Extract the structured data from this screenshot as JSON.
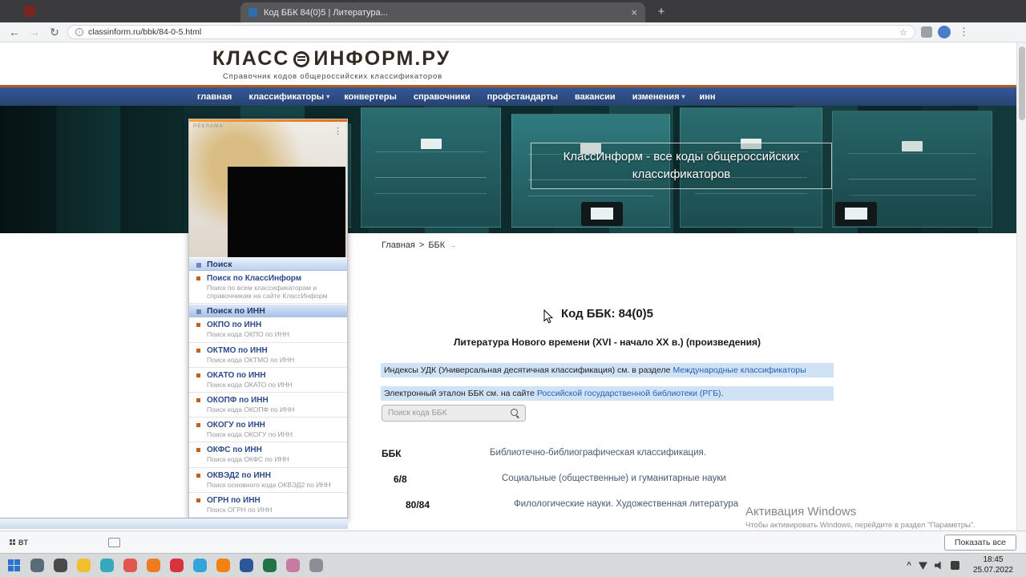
{
  "colors": {
    "accent_orange": "#d96f1e",
    "nav_blue": "#2d4f8e",
    "highlight_blue": "#cfe2f6",
    "link_blue": "#2a5db0"
  },
  "browser": {
    "tab": {
      "title": "Код ББК 84(0)5 | Литература...",
      "close_icon": "×",
      "new_tab_icon": "+"
    },
    "toolbar": {
      "back_icon": "←",
      "forward_icon": "→",
      "reload_icon": "↻",
      "info_icon": "i",
      "url": "classinform.ru/bbk/84-0-5.html",
      "bookmark_icon": "☆",
      "menu_icon": "⋮"
    }
  },
  "site": {
    "logo": {
      "first": "КЛАСС",
      "second": "ИНФОРМ.РУ",
      "tagline": "Справочник кодов общероссийских классификаторов"
    },
    "nav_items": [
      {
        "label": "главная"
      },
      {
        "label": "классификаторы",
        "arrow": "▾"
      },
      {
        "label": "конвертеры"
      },
      {
        "label": "справочники"
      },
      {
        "label": "профстандарты"
      },
      {
        "label": "вакансии"
      },
      {
        "label": "изменения",
        "arrow": "▾"
      },
      {
        "label": "инн"
      }
    ],
    "hero_title": "КлассИнформ - все коды общероссийских классификаторов",
    "sidebar": {
      "ad_label": "РЕКЛАМА",
      "ad_menu_icon": "⋮",
      "search_header": "Поиск",
      "search_items": [
        {
          "title": "Поиск по КлассИнформ",
          "desc": "Поиск по всем классификаторам и справочникам на сайте КлассИнформ"
        }
      ],
      "inn_header": "Поиск по ИНН",
      "inn_items": [
        {
          "title": "ОКПО по ИНН",
          "desc": "Поиск кода ОКПО по ИНН"
        },
        {
          "title": "ОКТМО по ИНН",
          "desc": "Поиск кода ОКТМО по ИНН"
        },
        {
          "title": "ОКАТО по ИНН",
          "desc": "Поиск кода ОКАТО по ИНН"
        },
        {
          "title": "ОКОПФ по ИНН",
          "desc": "Поиск кода ОКОПФ по ИНН"
        },
        {
          "title": "ОКОГУ по ИНН",
          "desc": "Поиск кода ОКОГУ по ИНН"
        },
        {
          "title": "ОКФС по ИНН",
          "desc": "Поиск кода ОКФС по ИНН"
        },
        {
          "title": "ОКВЭД2 по ИНН",
          "desc": "Поиск основного кода ОКВЭД2 по ИНН"
        },
        {
          "title": "ОГРН по ИНН",
          "desc": "Поиск ОГРН по ИНН"
        }
      ]
    },
    "content": {
      "breadcrumb": {
        "home": "Главная",
        "separator": ">",
        "current": "ББК",
        "arrow_icon": "→"
      },
      "title": "Код ББК: 84(0)5",
      "subtitle": "Литература Нового времени (XVI - начало XX в.) (произведения)",
      "notes": [
        {
          "before": "Индексы УДК (Универсальная десятичная классификация) см. в разделе ",
          "link": "Международные классификаторы",
          "after": ""
        },
        {
          "before": "Электронный эталон ББК см. на сайте ",
          "link": "Российской государственной библиотеки (РГБ)",
          "after": "."
        }
      ],
      "search_placeholder": "Поиск кода ББК",
      "hierarchy": [
        {
          "code": "ББК",
          "desc": "Библиотечно-библиографическая классификация."
        },
        {
          "code": "6/8",
          "desc": "Социальные (общественные) и гуманитарные науки"
        },
        {
          "code": "80/84",
          "desc": "Филологические науки. Художественная литература"
        }
      ]
    }
  },
  "activation": {
    "title": "Активация Windows",
    "subtitle": "Чтобы активировать Windows, перейдите в раздел \"Параметры\"."
  },
  "info_bar": {
    "left_label": "BT",
    "show_all_label": "Показать все"
  },
  "taskbar": {
    "apps": [
      {
        "name": "search-icon",
        "color": "#5a6b78"
      },
      {
        "name": "task-view-icon",
        "color": "#4a4a4a"
      },
      {
        "name": "file-explorer-icon",
        "color": "#f2c02e"
      },
      {
        "name": "edge-browser-icon",
        "color": "#35aabc"
      },
      {
        "name": "chrome-browser-icon",
        "color": "#e2574c"
      },
      {
        "name": "firefox-browser-icon",
        "color": "#f07a22"
      },
      {
        "name": "opera-browser-icon",
        "color": "#d8323c"
      },
      {
        "name": "telegram-icon",
        "color": "#31a5d8"
      },
      {
        "name": "vlc-player-icon",
        "color": "#f28313"
      },
      {
        "name": "word-icon",
        "color": "#2b579a"
      },
      {
        "name": "excel-icon",
        "color": "#217346"
      },
      {
        "name": "paint-icon",
        "color": "#c77ba0"
      },
      {
        "name": "settings-icon",
        "color": "#8a8f96"
      }
    ],
    "tray_chevron": "^",
    "clock": {
      "time": "18:45",
      "date": "25.07.2022"
    }
  }
}
